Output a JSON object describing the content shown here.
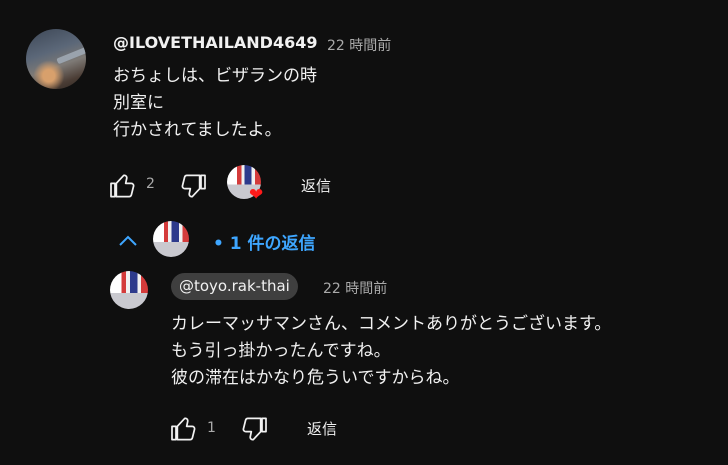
{
  "comment": {
    "author": "@ILOVETHAILAND4649",
    "time": "22 時間前",
    "text_lines": [
      "おちょしは、ビザランの時",
      "別室に",
      "行かされてましたよ。"
    ],
    "like_count": "2",
    "reply_label": "返信"
  },
  "replies_toggle": {
    "label": "• 1 件の返信"
  },
  "reply": {
    "author": "@toyo.rak-thai",
    "time": "22 時間前",
    "text_lines": [
      "カレーマッサマンさん、コメントありがとうございます。",
      "もう引っ掛かったんですね。",
      "彼の滞在はかなり危ういですからね。"
    ],
    "like_count": "1",
    "reply_label": "返信"
  },
  "colors": {
    "background": "#0f0f0f",
    "link_blue": "#3ea6ff",
    "heart_red": "#ff1a1a",
    "secondary_text": "#aaaaaa"
  },
  "icons": [
    "like-icon",
    "dislike-icon",
    "creator-heart-icon",
    "chevron-up-icon"
  ]
}
